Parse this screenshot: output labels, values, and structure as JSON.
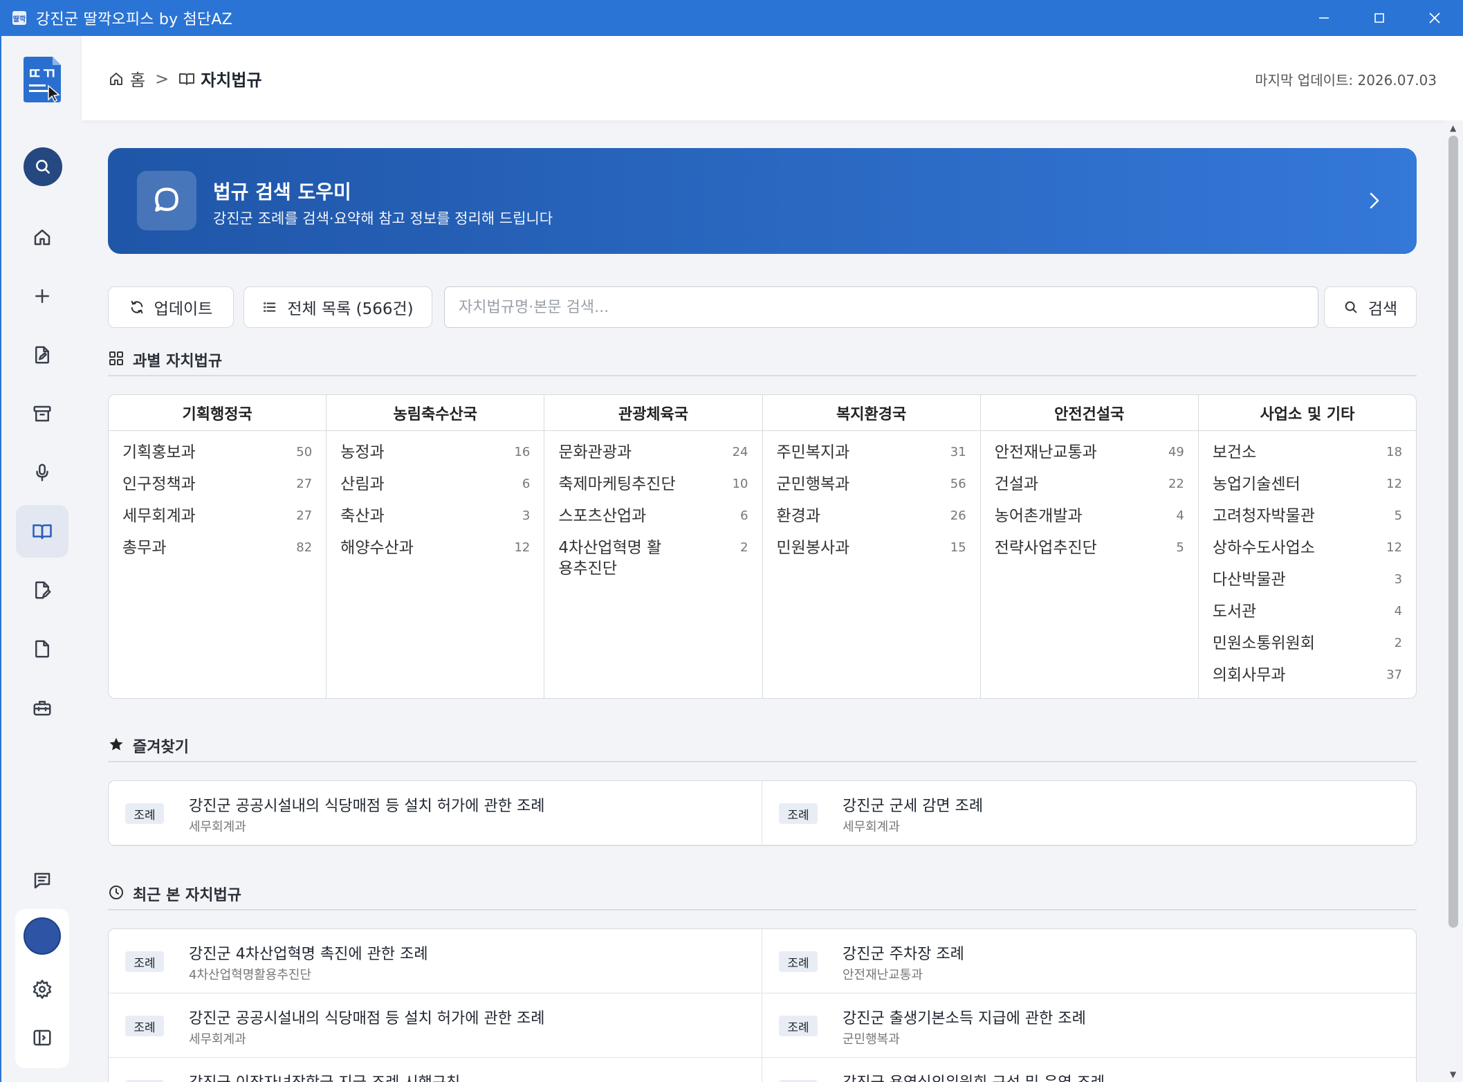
{
  "window": {
    "app_icon_text": "딸깍",
    "title": "강진군 딸깍오피스 by 첨단AZ"
  },
  "logo": {
    "text": "ㄸㄲ"
  },
  "header": {
    "home": "홈",
    "separator": ">",
    "current": "자치법규",
    "last_update": "마지막 업데이트: 2026.07.03"
  },
  "banner": {
    "title": "법규 검색 도우미",
    "subtitle": "강진군 조례를 검색·요약해 참고 정보를 정리해 드립니다"
  },
  "toolbar": {
    "update_label": "업데이트",
    "list_label": "전체 목록 (566건)",
    "search_placeholder": "자치법규명·본문 검색...",
    "search_button": "검색"
  },
  "sections": {
    "departments": "과별 자치법규",
    "favorites": "즐겨찾기",
    "recent": "최근 본 자치법규"
  },
  "departments": [
    {
      "name": "기획행정국",
      "items": [
        {
          "name": "기획홍보과",
          "count": "50"
        },
        {
          "name": "인구정책과",
          "count": "27"
        },
        {
          "name": "세무회계과",
          "count": "27"
        },
        {
          "name": "총무과",
          "count": "82"
        }
      ]
    },
    {
      "name": "농림축수산국",
      "items": [
        {
          "name": "농정과",
          "count": "16"
        },
        {
          "name": "산림과",
          "count": "6"
        },
        {
          "name": "축산과",
          "count": "3"
        },
        {
          "name": "해양수산과",
          "count": "12"
        }
      ]
    },
    {
      "name": "관광체육국",
      "items": [
        {
          "name": "문화관광과",
          "count": "24"
        },
        {
          "name": "축제마케팅추진단",
          "count": "10"
        },
        {
          "name": "스포츠산업과",
          "count": "6"
        },
        {
          "name": "4차산업혁명 활용추진단",
          "count": "2"
        }
      ]
    },
    {
      "name": "복지환경국",
      "items": [
        {
          "name": "주민복지과",
          "count": "31"
        },
        {
          "name": "군민행복과",
          "count": "56"
        },
        {
          "name": "환경과",
          "count": "26"
        },
        {
          "name": "민원봉사과",
          "count": "15"
        }
      ]
    },
    {
      "name": "안전건설국",
      "items": [
        {
          "name": "안전재난교통과",
          "count": "49"
        },
        {
          "name": "건설과",
          "count": "22"
        },
        {
          "name": "농어촌개발과",
          "count": "4"
        },
        {
          "name": "전략사업추진단",
          "count": "5"
        }
      ]
    },
    {
      "name": "사업소 및 기타",
      "items": [
        {
          "name": "보건소",
          "count": "18"
        },
        {
          "name": "농업기술센터",
          "count": "12"
        },
        {
          "name": "고려청자박물관",
          "count": "5"
        },
        {
          "name": "상하수도사업소",
          "count": "12"
        },
        {
          "name": "다산박물관",
          "count": "3"
        },
        {
          "name": "도서관",
          "count": "4"
        },
        {
          "name": "민원소통위원회",
          "count": "2"
        },
        {
          "name": "의회사무과",
          "count": "37"
        }
      ]
    }
  ],
  "favorites": [
    {
      "tag": "조례",
      "title": "강진군 공공시설내의 식당매점 등 설치 허가에 관한 조례",
      "dept": "세무회계과"
    },
    {
      "tag": "조례",
      "title": "강진군 군세 감면 조례",
      "dept": "세무회계과"
    }
  ],
  "recent": [
    {
      "tag": "조례",
      "title": "강진군 4차산업혁명 촉진에 관한 조례",
      "dept": "4차산업혁명활용추진단"
    },
    {
      "tag": "조례",
      "title": "강진군 주차장 조례",
      "dept": "안전재난교통과"
    },
    {
      "tag": "조례",
      "title": "강진군 공공시설내의 식당매점 등 설치 허가에 관한 조례",
      "dept": "세무회계과"
    },
    {
      "tag": "조례",
      "title": "강진군 출생기본소득 지급에 관한 조례",
      "dept": "군민행복과"
    },
    {
      "tag": "조례",
      "title": "강진군 이장자녀장학금 지급 조례 시행규칙",
      "dept": ""
    },
    {
      "tag": "조례",
      "title": "강진군 용역심의위원회 구성 및 운영 조례",
      "dept": ""
    }
  ],
  "colors": {
    "titlebar": "#2a74d6",
    "accent": "#2a5bbf",
    "banner_start": "#1f56a8",
    "banner_end": "#3478d8"
  }
}
